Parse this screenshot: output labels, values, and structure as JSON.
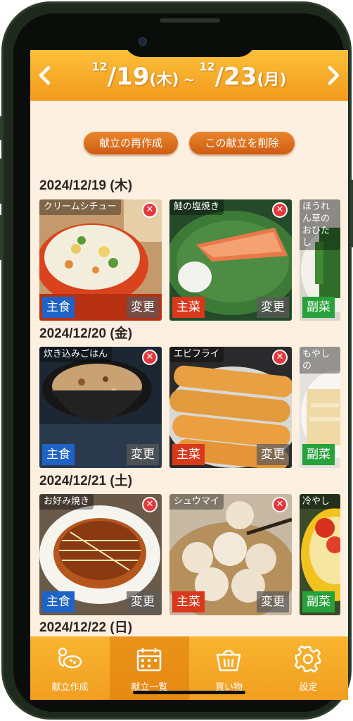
{
  "header": {
    "prev_label": "<",
    "next_label": ">",
    "start_month": "12",
    "start_day": "/19",
    "start_dow": "(木)",
    "separator": "~",
    "end_month": "12",
    "end_day": "/23",
    "end_dow": "(月)"
  },
  "actions": {
    "remake": "献立の再作成",
    "delete": "この献立を削除"
  },
  "days": [
    {
      "date": "2024/12/19 (木)",
      "meals": [
        {
          "name": "クリームシチュー",
          "category": "主食",
          "change": "変更"
        },
        {
          "name": "鮭の塩焼き",
          "category": "主菜",
          "change": "変更"
        },
        {
          "name": "ほうれん草のおひたし",
          "category": "副菜"
        }
      ]
    },
    {
      "date": "2024/12/20 (金)",
      "meals": [
        {
          "name": "炊き込みごはん",
          "category": "主食",
          "change": "変更"
        },
        {
          "name": "エビフライ",
          "category": "主菜",
          "change": "変更"
        },
        {
          "name": "もやしの",
          "category": "副菜"
        }
      ]
    },
    {
      "date": "2024/12/21 (土)",
      "meals": [
        {
          "name": "お好み焼き",
          "category": "主食",
          "change": "変更"
        },
        {
          "name": "シュウマイ",
          "category": "主菜",
          "change": "変更"
        },
        {
          "name": "冷やし",
          "category": "副菜"
        }
      ]
    },
    {
      "date": "2024/12/22 (日)"
    }
  ],
  "tabs": [
    {
      "label": "献立作成",
      "icon": "cooking-icon"
    },
    {
      "label": "献立一覧",
      "icon": "calendar-icon"
    },
    {
      "label": "買い物",
      "icon": "basket-icon"
    },
    {
      "label": "設定",
      "icon": "gear-icon"
    }
  ],
  "colors": {
    "header": "#f7a82a",
    "accent_button": "#d9671a",
    "category_staple": "#1f63c6",
    "category_main": "#d8381c",
    "category_side": "#27a13a",
    "delete": "#e2383e",
    "background": "#fdf0e1"
  }
}
